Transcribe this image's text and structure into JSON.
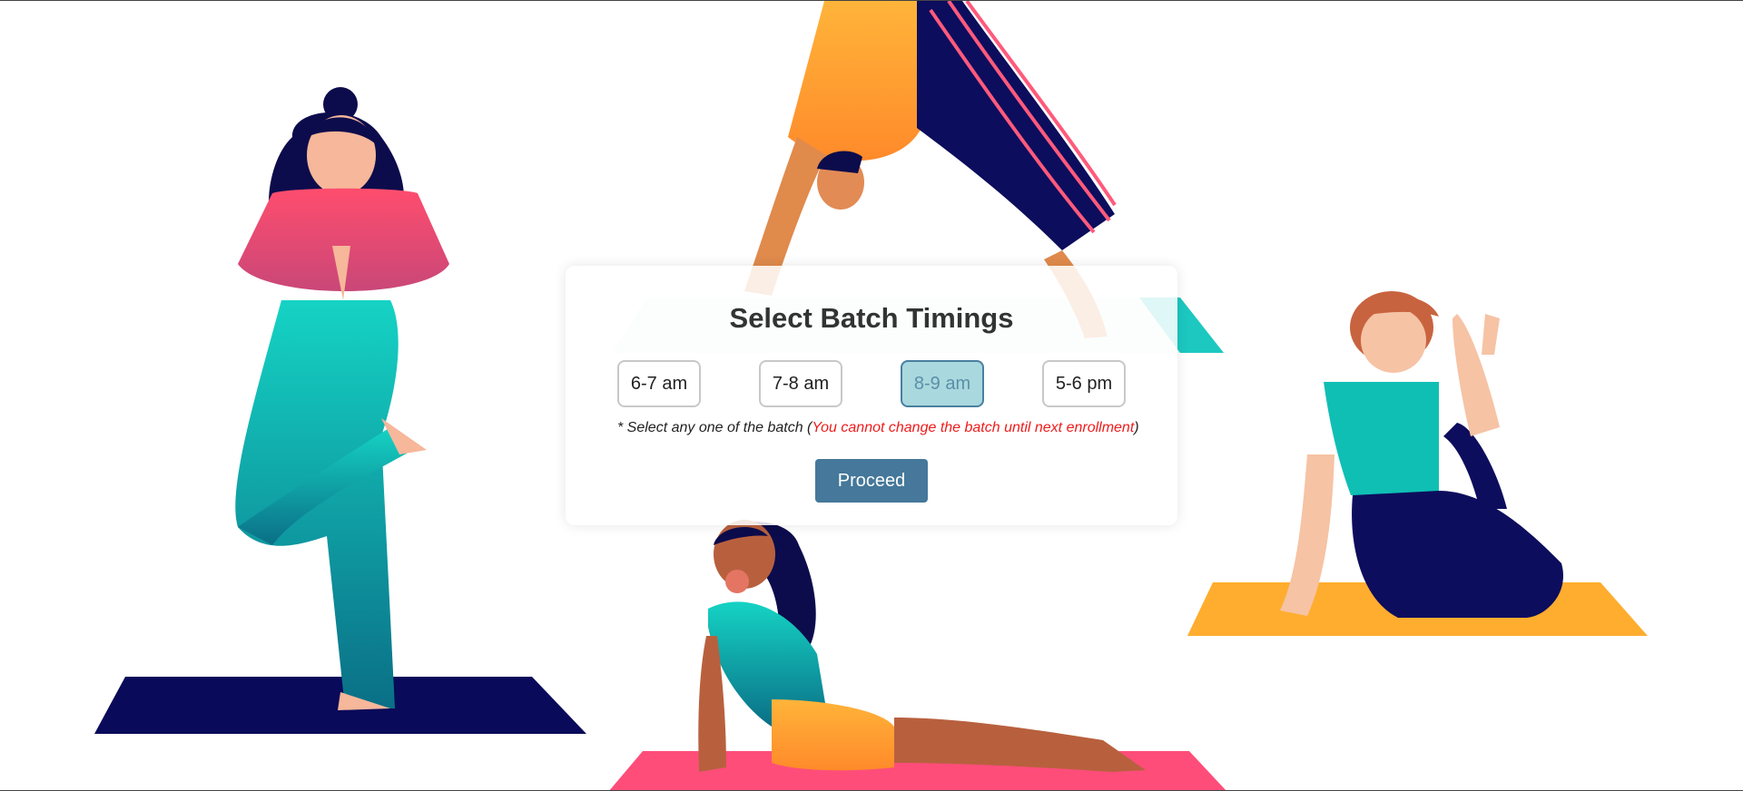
{
  "batch": {
    "title": "Select Batch Timings",
    "options": [
      "6-7 am",
      "7-8 am",
      "8-9 am",
      "5-6 pm"
    ],
    "selected": "8-9 am",
    "note_prefix": "* Select any one of the batch (",
    "note_warning": "You cannot change the batch until next enrollment",
    "note_suffix": ")",
    "proceed_label": "Proceed"
  },
  "colors": {
    "accent_button": "#45789a",
    "selected_fill": "#a9d9de",
    "warning_text": "#ee1c1c",
    "mat_navy": "#0a0a5a",
    "mat_teal": "#1cc8c0",
    "mat_orange": "#ffad2e",
    "mat_pink": "#ff4d7a"
  },
  "illustrations": [
    "tree-pose-figure",
    "downward-dog-figure",
    "seated-twist-figure",
    "cobra-pose-figure"
  ]
}
